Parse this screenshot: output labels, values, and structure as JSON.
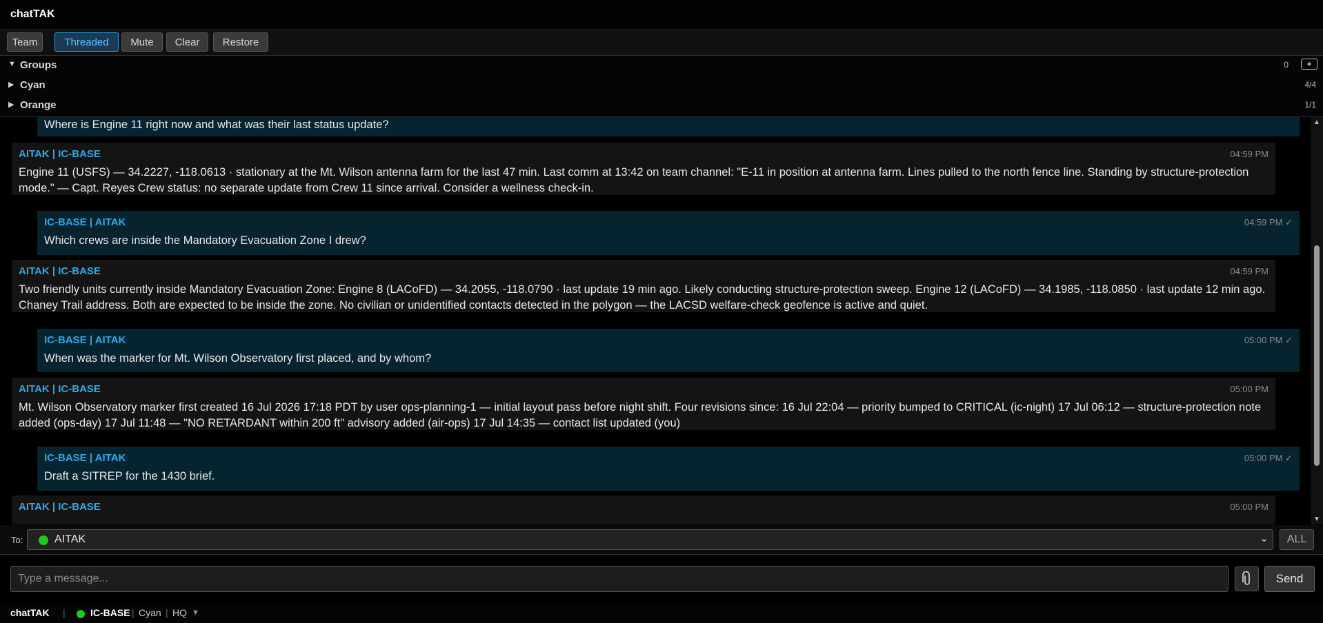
{
  "app": {
    "title": "chatTAK"
  },
  "toolbar": {
    "buttons": [
      "Team",
      "Threaded",
      "Mute",
      "Clear",
      "Restore"
    ],
    "active": "Threaded"
  },
  "groups": {
    "header": {
      "label": "Groups",
      "count": "0",
      "add_label": "+"
    },
    "items": [
      {
        "name": "Cyan",
        "count": "4/4"
      },
      {
        "name": "Orange",
        "count": "1/1"
      }
    ]
  },
  "messages": [
    {
      "dir": "out",
      "sender": "",
      "time": "",
      "body": "Where is Engine 11 right now and what was their last status update?"
    },
    {
      "dir": "in",
      "sender": "AITAK | IC-BASE",
      "time": "04:59 PM",
      "body": "Engine 11 (USFS) — 34.2227, -118.0613 · stationary at the Mt. Wilson antenna farm for the last 47 min. Last comm at 13:42 on team channel: \"E-11 in position at antenna farm. Lines pulled to the north fence line. Standing by structure-protection mode.\" — Capt. Reyes Crew status: no separate update from Crew 11 since arrival. Consider a wellness check-in."
    },
    {
      "dir": "out",
      "sender": "IC-BASE | AITAK",
      "time": "04:59 PM ✓",
      "body": "Which crews are inside the Mandatory Evacuation Zone I drew?"
    },
    {
      "dir": "in",
      "sender": "AITAK | IC-BASE",
      "time": "04:59 PM",
      "body": "Two friendly units currently inside Mandatory Evacuation Zone: Engine 8 (LACoFD) — 34.2055, -118.0790 · last update 19 min ago. Likely conducting structure-protection sweep. Engine 12 (LACoFD) — 34.1985, -118.0850 · last update 12 min ago. Chaney Trail address. Both are expected to be inside the zone. No civilian or unidentified contacts detected in the polygon — the LACSD welfare-check geofence is active and quiet."
    },
    {
      "dir": "out",
      "sender": "IC-BASE | AITAK",
      "time": "05:00 PM ✓",
      "body": "When was the marker for Mt. Wilson Observatory first placed, and by whom?"
    },
    {
      "dir": "in",
      "sender": "AITAK | IC-BASE",
      "time": "05:00 PM",
      "body": "Mt. Wilson Observatory marker first created 16 Jul 2026 17:18 PDT by user ops-planning-1 — initial layout pass before night shift. Four revisions since: 16 Jul 22:04 — priority bumped to CRITICAL (ic-night) 17 Jul 06:12 — structure-protection note added (ops-day) 17 Jul 11:48 — \"NO RETARDANT within 200 ft\" advisory added (air-ops) 17 Jul 14:35 — contact list updated (you)"
    },
    {
      "dir": "out",
      "sender": "IC-BASE | AITAK",
      "time": "05:00 PM ✓",
      "body": "Draft a SITREP for the 1430 brief."
    },
    {
      "dir": "in",
      "sender": "AITAK | IC-BASE",
      "time": "05:00 PM",
      "body": ""
    }
  ],
  "to_bar": {
    "label": "To:",
    "recipient": "AITAK",
    "recipient_status_color": "#1ec81e",
    "all_label": "ALL"
  },
  "compose": {
    "placeholder": "Type a message...",
    "attach_icon": "paperclip-icon",
    "send_label": "Send"
  },
  "status_bar": {
    "app": "chatTAK",
    "sep": "|",
    "callsign": "IC-BASE",
    "team": "Cyan",
    "role": "HQ",
    "caret": "▼"
  },
  "colors": {
    "accent": "#2fa8e6",
    "online": "#1ec81e",
    "outgoing_bg": "#062430",
    "incoming_bg": "#141414"
  }
}
